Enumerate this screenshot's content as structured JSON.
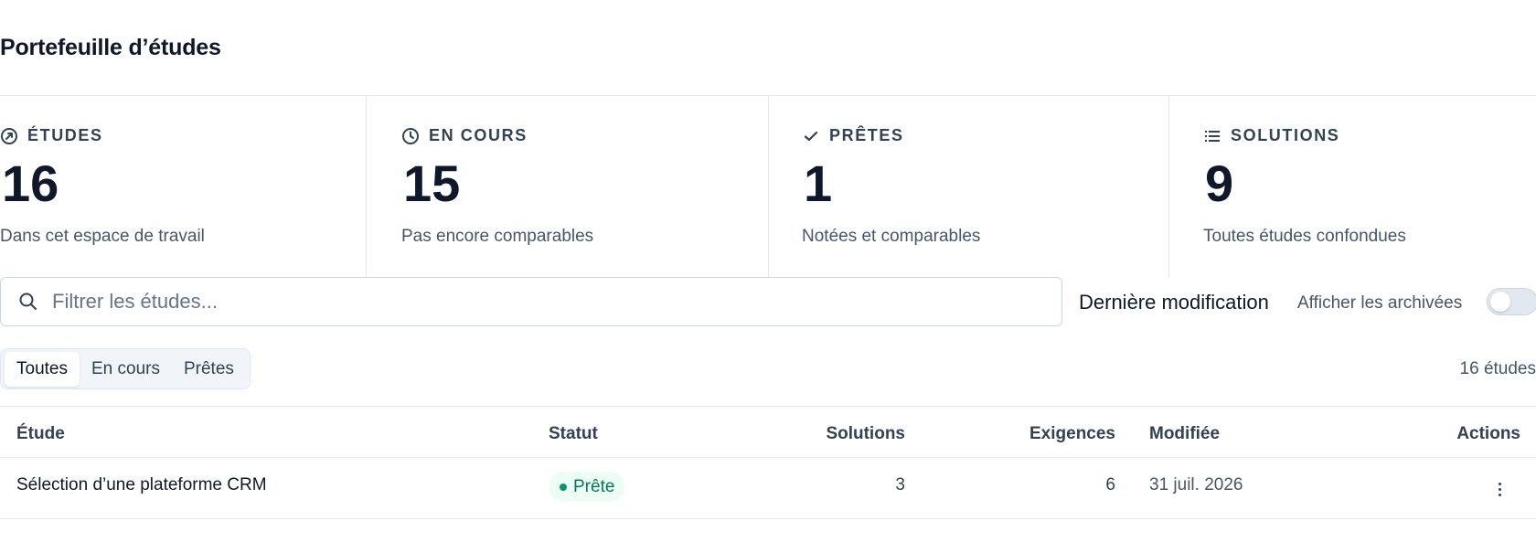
{
  "page": {
    "title": "Portefeuille d’études"
  },
  "stats": [
    {
      "icon": "compass-icon",
      "label": "ÉTUDES",
      "value": "16",
      "sub": "Dans cet espace de travail"
    },
    {
      "icon": "clock-icon",
      "label": "EN COURS",
      "value": "15",
      "sub": "Pas encore comparables"
    },
    {
      "icon": "check-icon",
      "label": "PRÊTES",
      "value": "1",
      "sub": "Notées et comparables"
    },
    {
      "icon": "list-icon",
      "label": "SOLUTIONS",
      "value": "9",
      "sub": "Toutes études confondues"
    }
  ],
  "filters": {
    "search_placeholder": "Filtrer les études...",
    "search_value": "",
    "sort_label": "Dernière modification",
    "archived_label": "Afficher les archivées",
    "archived_on": false
  },
  "tabs": [
    {
      "label": "Toutes",
      "active": true
    },
    {
      "label": "En cours",
      "active": false
    },
    {
      "label": "Prêtes",
      "active": false
    }
  ],
  "count_label": "16 études",
  "table": {
    "headers": {
      "study": "Étude",
      "status": "Statut",
      "solutions": "Solutions",
      "requirements": "Exigences",
      "modified": "Modifiée",
      "actions": "Actions"
    },
    "rows": [
      {
        "study": "Sélection d’une plateforme CRM",
        "status": "Prête",
        "solutions": "3",
        "requirements": "6",
        "modified": "31 juil. 2026"
      }
    ]
  },
  "colors": {
    "accent_green": "#059669",
    "badge_bg": "#ecfdf5",
    "border": "#e2e8f0",
    "text_primary": "#0f172a",
    "text_muted": "#475569"
  }
}
